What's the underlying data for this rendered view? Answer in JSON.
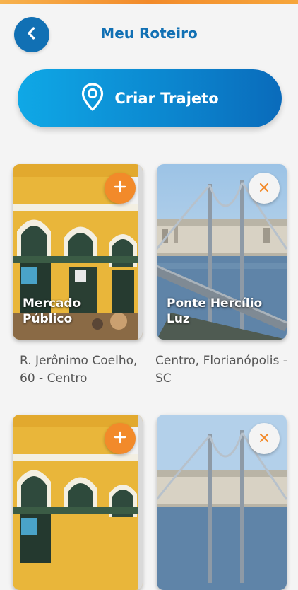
{
  "header": {
    "title": "Meu Roteiro",
    "back_icon": "chevron-left-icon"
  },
  "cta": {
    "label": "Criar Trajeto",
    "icon": "map-pin-icon"
  },
  "colors": {
    "primary": "#1170b4",
    "accent": "#f28a2a",
    "background": "#f4f4f4"
  },
  "cards": [
    {
      "name": "Mercado Público",
      "address": "R. Jerônimo Coelho, 60 - Centro",
      "action": "add"
    },
    {
      "name": "Ponte Hercílio Luz",
      "address": "Centro, Florianópolis - SC",
      "action": "remove"
    },
    {
      "name": "",
      "address": "",
      "action": "add"
    },
    {
      "name": "",
      "address": "",
      "action": "remove"
    }
  ]
}
